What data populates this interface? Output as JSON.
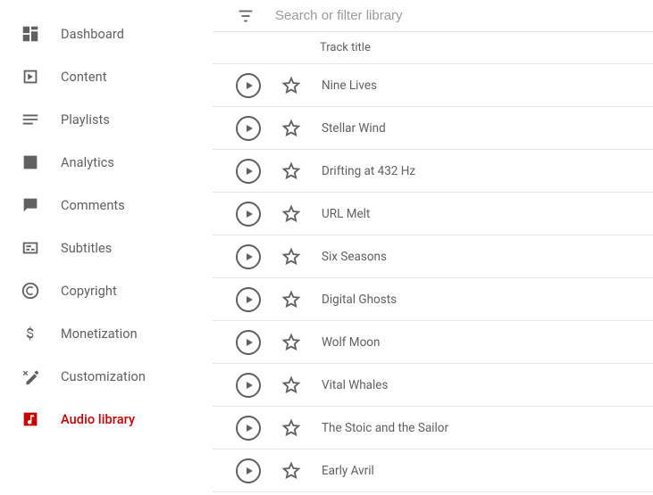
{
  "sidebar": {
    "items": [
      {
        "id": "dashboard",
        "label": "Dashboard",
        "icon": "dashboard-icon"
      },
      {
        "id": "content",
        "label": "Content",
        "icon": "content-icon"
      },
      {
        "id": "playlists",
        "label": "Playlists",
        "icon": "playlists-icon"
      },
      {
        "id": "analytics",
        "label": "Analytics",
        "icon": "analytics-icon"
      },
      {
        "id": "comments",
        "label": "Comments",
        "icon": "comments-icon"
      },
      {
        "id": "subtitles",
        "label": "Subtitles",
        "icon": "subtitles-icon"
      },
      {
        "id": "copyright",
        "label": "Copyright",
        "icon": "copyright-icon"
      },
      {
        "id": "monetization",
        "label": "Monetization",
        "icon": "monetization-icon"
      },
      {
        "id": "customization",
        "label": "Customization",
        "icon": "customization-icon"
      },
      {
        "id": "audio-library",
        "label": "Audio library",
        "icon": "audio-library-icon",
        "active": true
      }
    ]
  },
  "library": {
    "search_placeholder": "Search or filter library",
    "columns": {
      "title": "Track title"
    },
    "tracks": [
      {
        "title": "Nine Lives"
      },
      {
        "title": "Stellar Wind"
      },
      {
        "title": "Drifting at 432 Hz"
      },
      {
        "title": "URL Melt"
      },
      {
        "title": "Six Seasons"
      },
      {
        "title": "Digital Ghosts"
      },
      {
        "title": "Wolf Moon"
      },
      {
        "title": "Vital Whales"
      },
      {
        "title": "The Stoic and the Sailor"
      },
      {
        "title": "Early Avril"
      }
    ]
  },
  "colors": {
    "accent": "#cc0000",
    "text": "#606060",
    "border": "#e6e6e6"
  }
}
